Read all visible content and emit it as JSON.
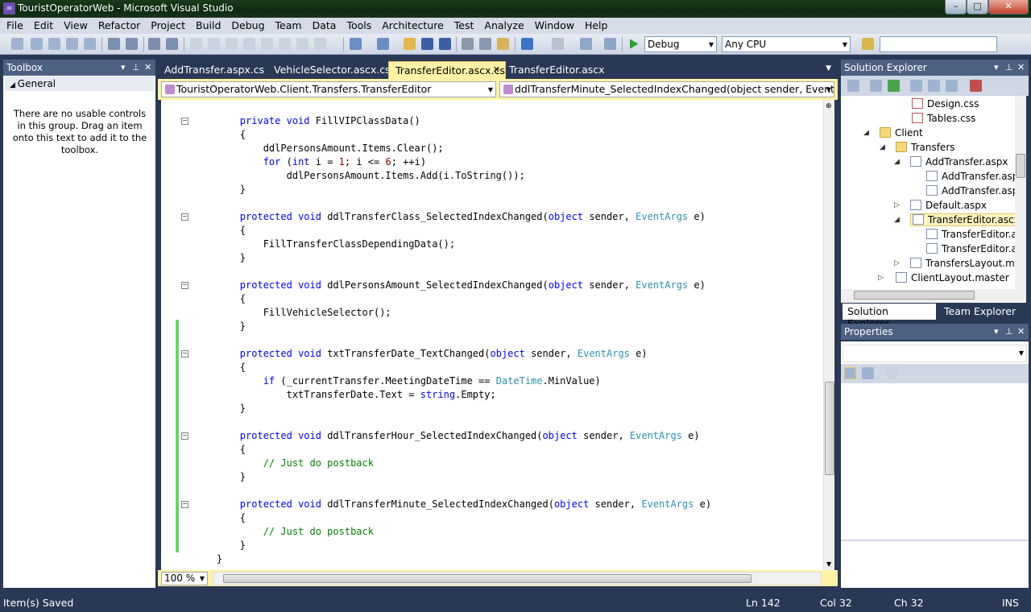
{
  "window": {
    "title": "TouristOperatorWeb - Microsoft Visual Studio",
    "min": "–",
    "max": "□",
    "close": "✕"
  },
  "menu": [
    "File",
    "Edit",
    "View",
    "Refactor",
    "Project",
    "Build",
    "Debug",
    "Team",
    "Data",
    "Tools",
    "Architecture",
    "Test",
    "Analyze",
    "Window",
    "Help"
  ],
  "toolbar": {
    "config": "Debug",
    "platform": "Any CPU",
    "search_value": ""
  },
  "toolbox": {
    "title": "Toolbox",
    "group": "General",
    "message": "There are no usable controls in this group. Drag an item onto this text to add it to the toolbox."
  },
  "doc_tabs": [
    {
      "label": "AddTransfer.aspx.cs"
    },
    {
      "label": "VehicleSelector.ascx.cs"
    },
    {
      "label": "TransferEditor.ascx.cs"
    },
    {
      "label": "TransferEditor.ascx"
    }
  ],
  "nav": {
    "class_combo": "TouristOperatorWeb.Client.Transfers.TransferEditor",
    "member_combo": "ddlTransferMinute_SelectedIndexChanged(object sender, EventArgs e)"
  },
  "code": [
    "        private void FillVIPClassData()",
    "        {",
    "            ddlPersonsAmount.Items.Clear();",
    "            for (int i = 1; i <= 6; ++i)",
    "                ddlPersonsAmount.Items.Add(i.ToString());",
    "        }",
    "",
    "        protected void ddlTransferClass_SelectedIndexChanged(object sender, EventArgs e)",
    "        {",
    "            FillTransferClassDependingData();",
    "        }",
    "",
    "        protected void ddlPersonsAmount_SelectedIndexChanged(object sender, EventArgs e)",
    "        {",
    "            FillVehicleSelector();",
    "        }",
    "",
    "        protected void txtTransferDate_TextChanged(object sender, EventArgs e)",
    "        {",
    "            if (_currentTransfer.MeetingDateTime == DateTime.MinValue)",
    "                txtTransferDate.Text = string.Empty;",
    "        }",
    "",
    "        protected void ddlTransferHour_SelectedIndexChanged(object sender, EventArgs e)",
    "        {",
    "            // Just do postback",
    "        }",
    "",
    "        protected void ddlTransferMinute_SelectedIndexChanged(object sender, EventArgs e)",
    "        {",
    "            // Just do postback",
    "        }",
    "    }"
  ],
  "editor": {
    "zoom": "100 %"
  },
  "solution_explorer": {
    "title": "Solution Explorer",
    "items": [
      {
        "label": "Design.css",
        "icon": "css-file-icon"
      },
      {
        "label": "Tables.css",
        "icon": "css-file-icon"
      },
      {
        "label": "Client",
        "icon": "folder-icon"
      },
      {
        "label": "Transfers",
        "icon": "folder-icon"
      },
      {
        "label": "AddTransfer.aspx",
        "icon": "aspx-file-icon"
      },
      {
        "label": "AddTransfer.asp",
        "icon": "code-file-icon"
      },
      {
        "label": "AddTransfer.asp",
        "icon": "code-file-icon"
      },
      {
        "label": "Default.aspx",
        "icon": "aspx-file-icon"
      },
      {
        "label": "TransferEditor.ascx",
        "icon": "ascx-file-icon"
      },
      {
        "label": "TransferEditor.as",
        "icon": "code-file-icon"
      },
      {
        "label": "TransferEditor.as",
        "icon": "code-file-icon"
      },
      {
        "label": "TransfersLayout.ma",
        "icon": "master-file-icon"
      },
      {
        "label": "ClientLayout.master",
        "icon": "master-file-icon"
      }
    ],
    "tabs": [
      "Solution Explorer",
      "Team Explorer"
    ]
  },
  "properties": {
    "title": "Properties"
  },
  "status": {
    "message": "Item(s) Saved",
    "ln": "Ln 142",
    "col": "Col 32",
    "ch": "Ch 32",
    "mode": "INS"
  }
}
